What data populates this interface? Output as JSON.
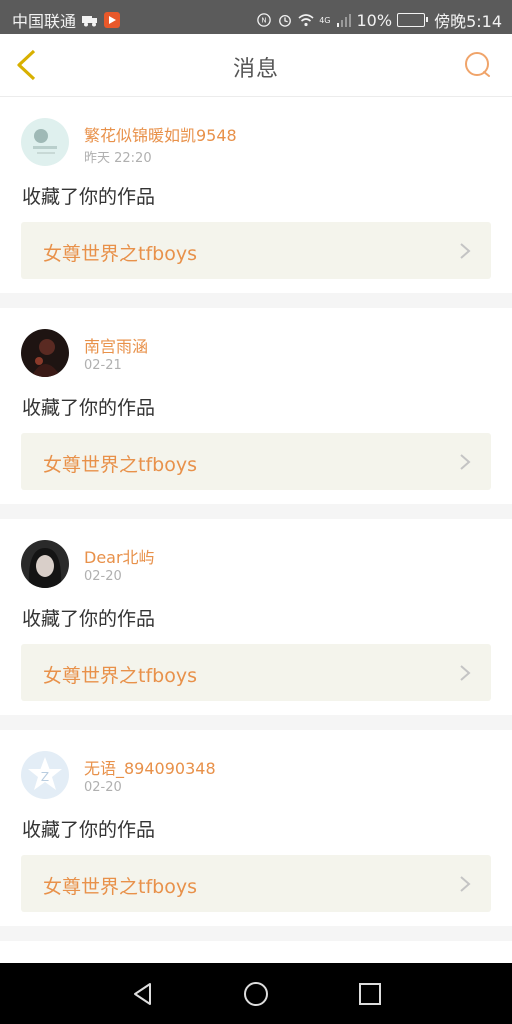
{
  "status_bar": {
    "carrier": "中国联通",
    "network_badge": "4G",
    "battery_percent": "10%",
    "time": "傍晚5:14"
  },
  "header": {
    "title": "消息",
    "back_icon": "chevron-left-icon",
    "search_icon": "search-icon"
  },
  "colors": {
    "accent": "#e8914a",
    "back_arrow": "#d8b000",
    "work_bg": "#f4f4ec"
  },
  "notifications": [
    {
      "username": "繁花似锦暖如凯9548",
      "time": "昨天 22:20",
      "action": "收藏了你的作品",
      "work_title": "女尊世界之tfboys"
    },
    {
      "username": "南宫雨涵",
      "time": "02-21",
      "action": "收藏了你的作品",
      "work_title": "女尊世界之tfboys"
    },
    {
      "username": "Dear北屿",
      "time": "02-20",
      "action": "收藏了你的作品",
      "work_title": "女尊世界之tfboys"
    },
    {
      "username": "无语_894090348",
      "time": "02-20",
      "action": "收藏了你的作品",
      "work_title": "女尊世界之tfboys"
    }
  ]
}
